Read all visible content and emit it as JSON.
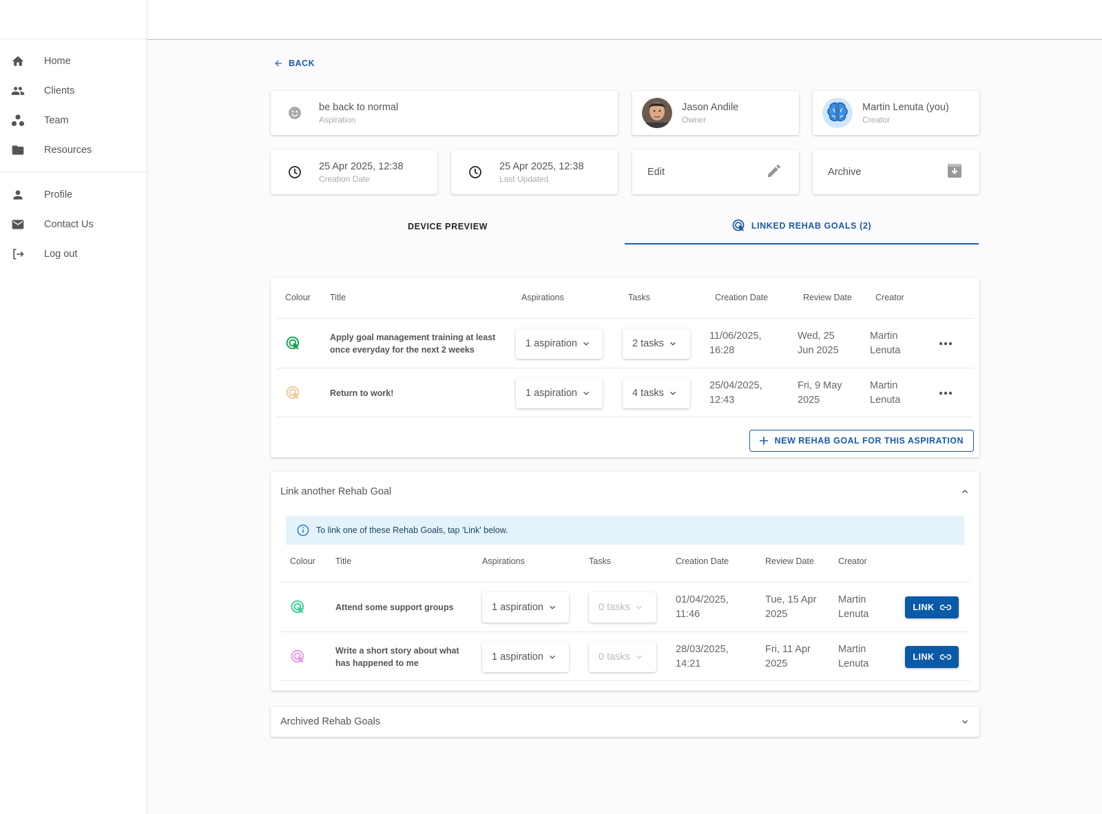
{
  "sidebar": {
    "items": [
      {
        "label": "Home",
        "icon": "home-icon"
      },
      {
        "label": "Clients",
        "icon": "clients-icon"
      },
      {
        "label": "Team",
        "icon": "team-icon"
      },
      {
        "label": "Resources",
        "icon": "folder-icon"
      }
    ],
    "items2": [
      {
        "label": "Profile",
        "icon": "person-icon"
      },
      {
        "label": "Contact Us",
        "icon": "mail-icon"
      },
      {
        "label": "Log out",
        "icon": "logout-icon"
      }
    ]
  },
  "back_label": "BACK",
  "summary": {
    "aspiration": {
      "title": "be back to normal",
      "sub": "Aspiration"
    },
    "owner": {
      "name": "Jason Andile",
      "sub": "Owner"
    },
    "creator": {
      "name": "Martin Lenuta (you)",
      "sub": "Creator"
    },
    "created": {
      "value": "25 Apr 2025, 12:38",
      "sub": "Creation Date"
    },
    "updated": {
      "value": "25 Apr 2025, 12:38",
      "sub": "Last Updated"
    },
    "edit_label": "Edit",
    "archive_label": "Archive"
  },
  "tabs": {
    "device_preview": "DEVICE PREVIEW",
    "linked_goals": "LINKED REHAB GOALS (2)"
  },
  "linked": {
    "headers": {
      "colour": "Colour",
      "title": "Title",
      "aspirations": "Aspirations",
      "tasks": "Tasks",
      "creation": "Creation Date",
      "review": "Review Date",
      "creator": "Creator"
    },
    "rows": [
      {
        "color": "#1f9e55",
        "title_1": "Apply goal management training at least",
        "title_2": "once everyday for the next 2 weeks",
        "aspirations": "1 aspiration",
        "tasks": "2 tasks",
        "creation_1": "11/06/2025,",
        "creation_2": "16:28",
        "review_1": "Wed, 25",
        "review_2": "Jun 2025",
        "creator_1": "Martin",
        "creator_2": "Lenuta"
      },
      {
        "color": "#f3c99a",
        "title_1": "Return to work!",
        "title_2": "",
        "aspirations": "1 aspiration",
        "tasks": "4 tasks",
        "creation_1": "25/04/2025,",
        "creation_2": "12:43",
        "review_1": "Fri, 9 May",
        "review_2": "2025",
        "creator_1": "Martin",
        "creator_2": "Lenuta"
      }
    ],
    "new_button": "NEW REHAB GOAL FOR THIS ASPIRATION"
  },
  "link_another": {
    "heading": "Link another Rehab Goal",
    "info": "To link one of these Rehab Goals, tap 'Link' below.",
    "headers": {
      "colour": "Colour",
      "title": "Title",
      "aspirations": "Aspirations",
      "tasks": "Tasks",
      "creation": "Creation Date",
      "review": "Review Date",
      "creator": "Creator"
    },
    "rows": [
      {
        "color": "#3fcfa0",
        "title_1": "Attend some support groups",
        "title_2": "",
        "aspirations": "1 aspiration",
        "tasks": "0 tasks",
        "creation_1": "01/04/2025,",
        "creation_2": "11:46",
        "review_1": "Tue, 15 Apr",
        "review_2": "2025",
        "creator_1": "Martin",
        "creator_2": "Lenuta",
        "link": "LINK"
      },
      {
        "color": "#e59be6",
        "title_1": "Write a short story about what",
        "title_2": "has happened to me",
        "aspirations": "1 aspiration",
        "tasks": "0 tasks",
        "creation_1": "28/03/2025,",
        "creation_2": "14:21",
        "review_1": "Fri, 11 Apr",
        "review_2": "2025",
        "creator_1": "Martin",
        "creator_2": "Lenuta",
        "link": "LINK"
      }
    ]
  },
  "archived": {
    "heading": "Archived Rehab Goals"
  },
  "colors": {
    "accent": "#1a5aa6",
    "button": "#0b5aa8",
    "info_bg": "#e4f3fb"
  }
}
